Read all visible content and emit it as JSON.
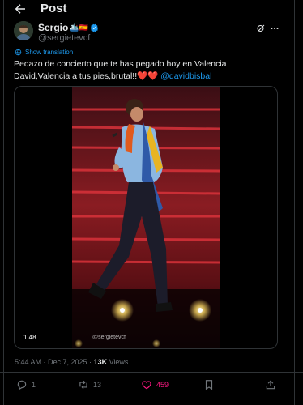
{
  "header": {
    "title": "Post"
  },
  "author": {
    "name": "Sergio",
    "name_emojis": "🛳️🇪🇸",
    "handle": "@sergietevcf"
  },
  "translate": {
    "label": "Show translation"
  },
  "tweet": {
    "text": "Pedazo de concierto que te has  pegado hoy en Valencia David,Valencia a tus pies,brutal!!",
    "hearts": "❤️❤️",
    "mention": "@davidbisbal"
  },
  "media": {
    "duration": "1:48",
    "watermark": "@sergietevcf"
  },
  "meta": {
    "datetime": "5:44 AM · Dec 7, 2025 · ",
    "views_count": "13K",
    "views_label": " Views"
  },
  "actions": {
    "replies": "1",
    "reposts": "13",
    "likes": "459"
  },
  "colors": {
    "accent": "#1d9bf0",
    "like": "#f91880",
    "muted": "#71767b",
    "text": "#e7e9ea",
    "border": "#2f3336"
  },
  "icons": [
    "back-arrow-icon",
    "verified-badge-icon",
    "grok-icon",
    "more-icon",
    "translate-icon",
    "reply-icon",
    "repost-icon",
    "like-icon",
    "bookmark-icon",
    "share-icon"
  ]
}
